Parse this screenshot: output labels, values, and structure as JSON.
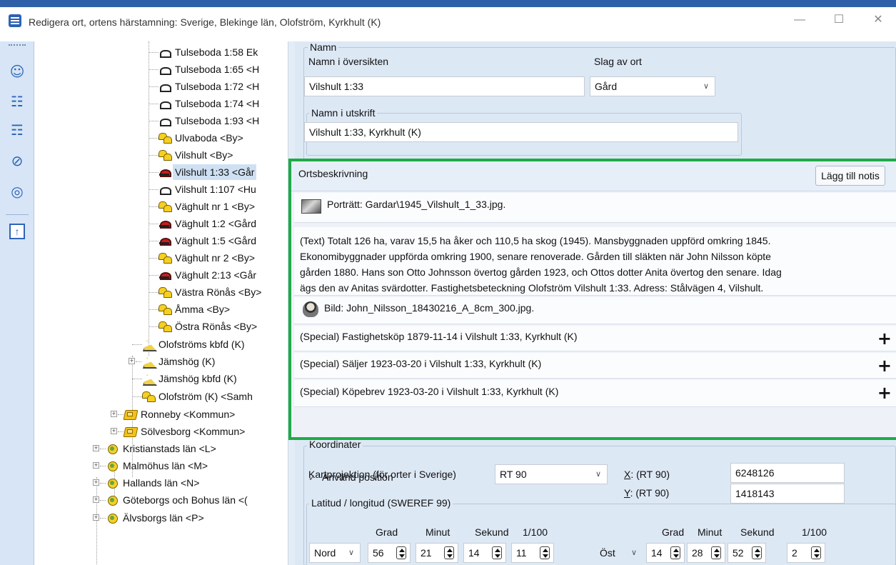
{
  "window": {
    "title": "Redigera ort, ortens härstamning: Sverige, Blekinge län, Olofström, Kyrkhult (K)",
    "minimize": "—",
    "maximize": "☐",
    "close": "✕"
  },
  "sidebar": {
    "icons": [
      "people-icon",
      "tree-icon",
      "branch-icon",
      "pin-off-icon",
      "location-pin-icon",
      "upload-box-icon"
    ]
  },
  "tree": {
    "nodes": [
      {
        "label": "Tulseboda 1:58 Ek",
        "icon": "house"
      },
      {
        "label": "Tulseboda 1:65 <H",
        "icon": "house"
      },
      {
        "label": "Tulseboda 1:72 <H",
        "icon": "house"
      },
      {
        "label": "Tulseboda 1:74 <H",
        "icon": "house"
      },
      {
        "label": "Tulseboda 1:93 <H",
        "icon": "house"
      },
      {
        "label": "Ulvaboda <By>",
        "icon": "by"
      },
      {
        "label": "Vilshult <By>",
        "icon": "by"
      },
      {
        "label": "Vilshult 1:33 <Går",
        "icon": "house-red",
        "selected": true
      },
      {
        "label": "Vilshult 1:107 <Hu",
        "icon": "house"
      },
      {
        "label": "Väghult nr 1 <By>",
        "icon": "by"
      },
      {
        "label": "Väghult 1:2 <Gård",
        "icon": "house-red"
      },
      {
        "label": "Väghult 1:5 <Gård",
        "icon": "house-red"
      },
      {
        "label": "Väghult nr 2 <By>",
        "icon": "by"
      },
      {
        "label": "Väghult 2:13 <Går",
        "icon": "house-red"
      },
      {
        "label": "Västra Rönås <By>",
        "icon": "by"
      },
      {
        "label": "Åmma <By>",
        "icon": "by"
      },
      {
        "label": "Östra Rönås <By>",
        "icon": "by"
      },
      {
        "label": "Olofströms kbfd (K)",
        "icon": "kbfd"
      },
      {
        "label": "Jämshög (K)",
        "icon": "kbfd"
      },
      {
        "label": "Jämshög kbfd (K)",
        "icon": "kbfd"
      },
      {
        "label": "Olofström (K) <Samh",
        "icon": "by"
      },
      {
        "label": "Ronneby <Kommun>",
        "icon": "kommun"
      },
      {
        "label": "Sölvesborg <Kommun>",
        "icon": "kommun"
      },
      {
        "label": "Kristianstads län <L>",
        "icon": "lan"
      },
      {
        "label": "Malmöhus län <M>",
        "icon": "lan"
      },
      {
        "label": "Hallands län <N>",
        "icon": "lan"
      },
      {
        "label": "Göteborgs och Bohus län <(",
        "icon": "lan"
      },
      {
        "label": "Älvsborgs län <P>",
        "icon": "lan"
      }
    ]
  },
  "namn": {
    "legend": "Namn",
    "oversikt_label": "Namn i översikten",
    "oversikt_value": "Vilshult 1:33",
    "slag_label": "Slag av ort",
    "slag_value": "Gård",
    "utskrift_legend": "Namn i utskrift",
    "utskrift_value": "Vilshult 1:33, Kyrkhult (K)"
  },
  "ortsbeskrivning": {
    "title": "Ortsbeskrivning",
    "add_button": "Lägg till notis",
    "portrait": "Porträtt: Gardar\\1945_Vilshult_1_33.jpg.",
    "text_lines": [
      "(Text) Totalt 126 ha, varav 15,5 ha åker och 110,5 ha skog (1945). Mansbyggnaden uppförd omkring 1845.",
      "Ekonomibyggnader uppförda omkring 1900, senare renoverade. Gården till släkten när John Nilsson köpte",
      "gården 1880. Hans son Otto Johnsson övertog gården 1923, och Ottos dotter Anita övertog den senare. Idag",
      "ägs den av Anitas svärdotter. Fastighetsbeteckning Olofström Vilshult 1:33. Adress: Stålvägen 4, Vilshult."
    ],
    "bild": "Bild: John_Nilsson_18430216_A_8cm_300.jpg.",
    "specials": [
      "(Special) Fastighetsköp 1879-11-14 i Vilshult 1:33, Kyrkhult (K)",
      "(Special) Säljer 1923-03-20 i Vilshult 1:33, Kyrkhult (K)",
      "(Special) Köpebrev 1923-03-20 i Vilshult 1:33, Kyrkhult (K)"
    ],
    "plus": "+"
  },
  "koordinater": {
    "legend": "Koordinater",
    "kartprojektion_label": "Kartprojektion (för orter i Sverige)",
    "kartprojektion_value": "RT 90",
    "x_key": "X",
    "x_label": ": (RT 90)",
    "x_value": "6248126",
    "y_key": "Y",
    "y_label": ": (RT 90)",
    "y_value": "1418143",
    "anvand_position": "Använd position",
    "latlong_legend": "Latitud / longitud (SWEREF 99)",
    "headers_left": [
      "Grad",
      "Minut",
      "Sekund",
      "1/100"
    ],
    "headers_right": [
      "Grad",
      "Minut",
      "Sekund",
      "1/100"
    ],
    "lat_dir": "Nord",
    "lat_values": [
      "56",
      "21",
      "14",
      "11"
    ],
    "lon_dir": "Öst",
    "lon_values": [
      "14",
      "28",
      "52",
      "2"
    ]
  }
}
